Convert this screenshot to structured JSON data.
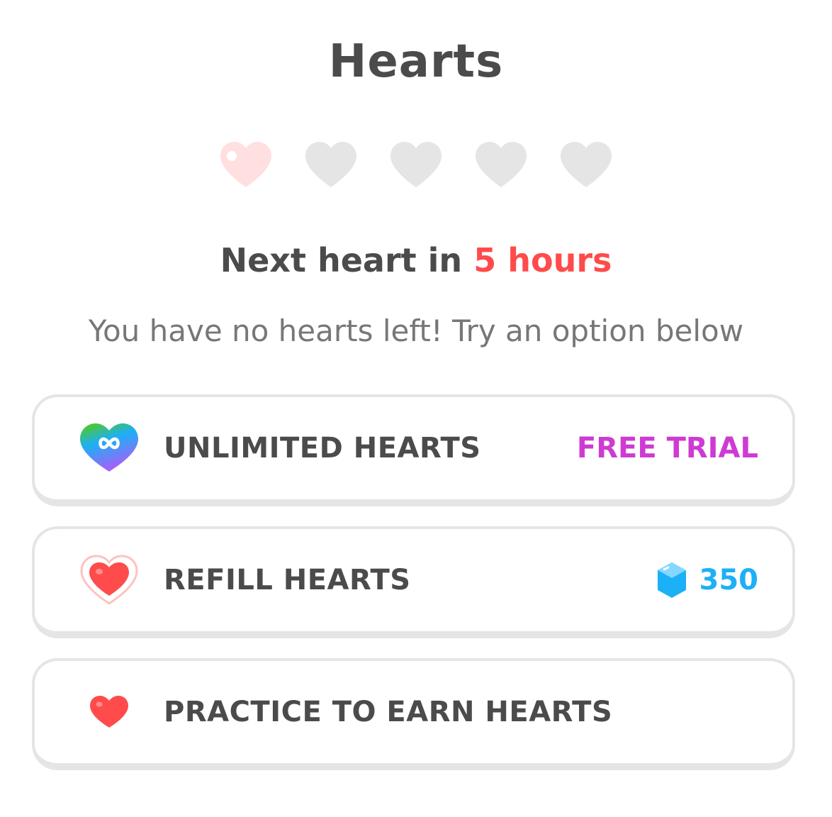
{
  "header": {
    "title": "Hearts"
  },
  "hearts": {
    "total": 5,
    "filled": 0,
    "slots": [
      "regenerating",
      "empty",
      "empty",
      "empty",
      "empty"
    ]
  },
  "status": {
    "prefix": "Next heart in",
    "time": "5 hours"
  },
  "message": "You have no hearts left! Try an option below",
  "options": [
    {
      "icon": "infinity-heart-icon",
      "label": "UNLIMITED HEARTS",
      "right_text": "FREE TRIAL"
    },
    {
      "icon": "refill-heart-icon",
      "label": "REFILL HEARTS",
      "right_icon": "gem-icon",
      "right_text": "350"
    },
    {
      "icon": "heart-icon",
      "label": "PRACTICE TO EARN HEARTS"
    }
  ],
  "colors": {
    "text": "#4b4b4b",
    "subtext": "#777777",
    "accent_red": "#ff4b4b",
    "trial_purple": "#ce3bd2",
    "gem_blue": "#1cb0f6",
    "empty_heart": "#e5e5e5",
    "regen_heart": "#ffdfe0"
  }
}
